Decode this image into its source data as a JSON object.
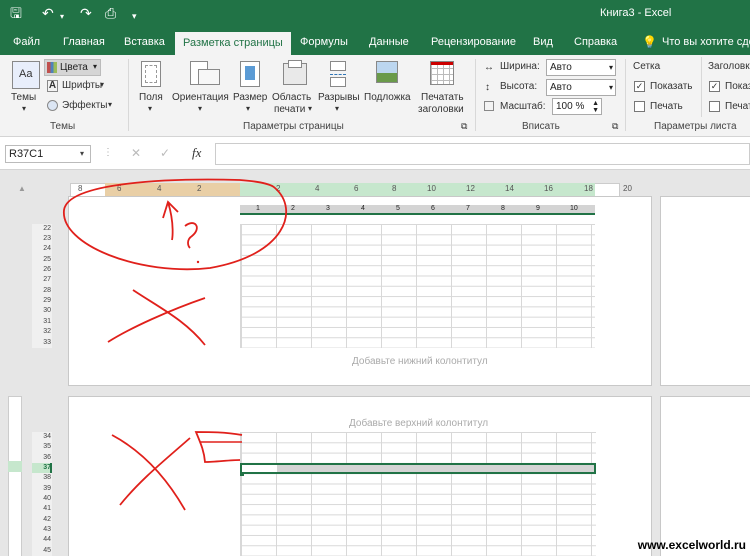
{
  "app": {
    "doc_title": "Книга3  -  Excel",
    "watermark": "www.excelworld.ru"
  },
  "quick_access": {
    "save_icon": "save-icon",
    "undo_icon": "undo-icon",
    "redo_icon": "redo-icon",
    "preview_icon": "print-preview-icon",
    "customize_icon": "customize-qat-icon"
  },
  "tabs": [
    "Файл",
    "Главная",
    "Вставка",
    "Разметка страницы",
    "Формулы",
    "Данные",
    "Рецензирование",
    "Вид",
    "Справка",
    "Что вы хотите сдел"
  ],
  "ribbon": {
    "themes": {
      "big_label": "Темы",
      "colors": "Цвета",
      "fonts": "Шрифты",
      "effects": "Эффекты",
      "group": "Темы"
    },
    "page_setup": {
      "margins": "Поля",
      "orientation": "Ориентация",
      "size": "Размер",
      "print_area_1": "Область",
      "print_area_2": "печати",
      "breaks": "Разрывы",
      "background": "Подложка",
      "print_titles_1": "Печатать",
      "print_titles_2": "заголовки",
      "group": "Параметры страницы"
    },
    "fit": {
      "width_label": "Ширина:",
      "width_value": "Авто",
      "height_label": "Высота:",
      "height_value": "Авто",
      "scale_label": "Масштаб:",
      "scale_value": "100 %",
      "group": "Вписать"
    },
    "sheet_options": {
      "gridlines": "Сетка",
      "headings": "Заголовк",
      "show": "Показать",
      "print": "Печать",
      "group": "Параметры листа"
    }
  },
  "formula_bar": {
    "name_box": "R37C1",
    "cancel": "✕",
    "enter": "✓",
    "fx": "fx",
    "value": ""
  },
  "rulers": {
    "h_top_left": [
      "8",
      "6",
      "4",
      "2"
    ],
    "h_top_right": [
      "2",
      "4",
      "6",
      "8",
      "10",
      "12",
      "14",
      "16",
      "18",
      "20"
    ],
    "h_columns": [
      "1",
      "2",
      "3",
      "4",
      "5",
      "6",
      "7",
      "8",
      "9",
      "10"
    ]
  },
  "page1": {
    "rows": [
      "22",
      "23",
      "24",
      "25",
      "26",
      "27",
      "28",
      "29",
      "30",
      "31",
      "32",
      "33"
    ],
    "footer": "Добавьте нижний колонтитул"
  },
  "page2": {
    "rows": [
      "34",
      "35",
      "36",
      "37",
      "38",
      "39",
      "40",
      "41",
      "42",
      "43",
      "44",
      "45"
    ],
    "header": "Добавьте верхний колонтитул",
    "selected_row": "37"
  }
}
